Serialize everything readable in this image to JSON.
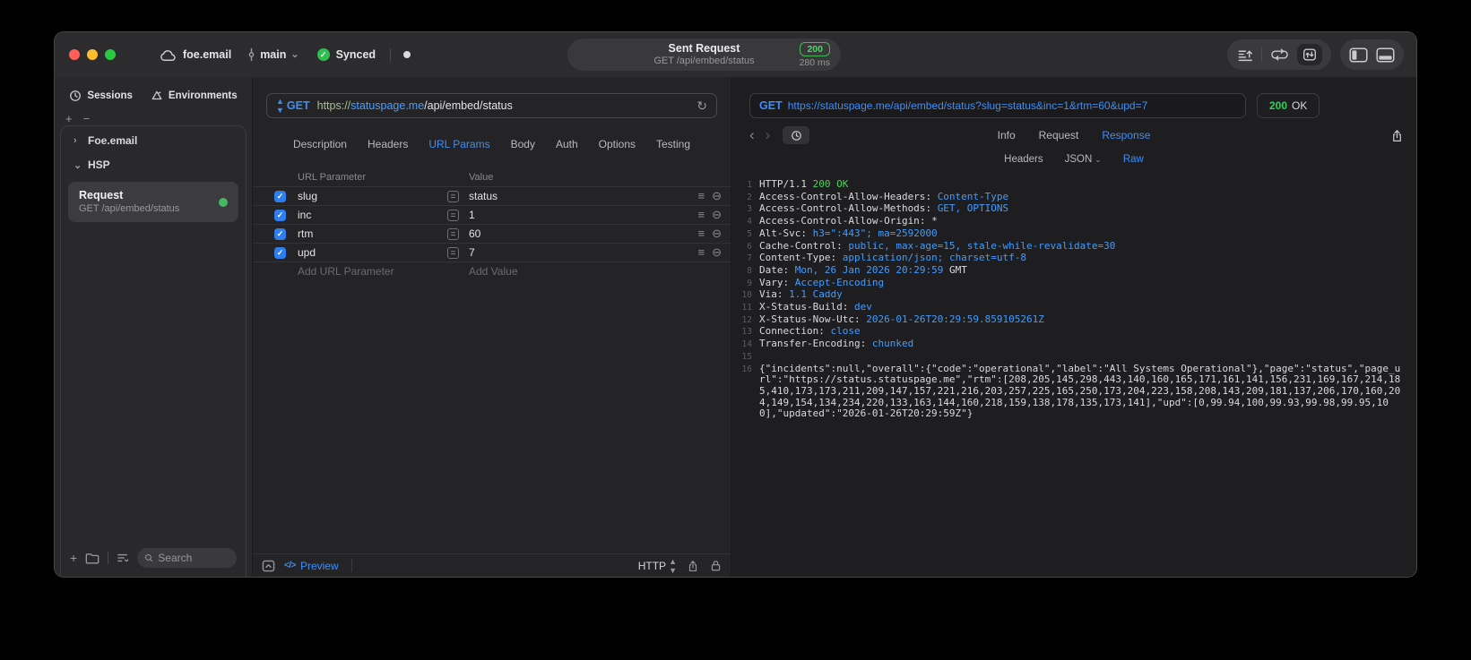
{
  "titlebar": {
    "project": "foe.email",
    "branch": "main",
    "sync_status": "Synced",
    "request_summary": {
      "title": "Sent Request",
      "subtitle": "GET /api/embed/status",
      "status_code": "200",
      "duration": "280 ms"
    }
  },
  "sidebar": {
    "tabs": [
      {
        "label": "Sessions"
      },
      {
        "label": "Environments"
      }
    ],
    "tree": [
      {
        "label": "Foe.email",
        "state": "collapsed"
      },
      {
        "label": "HSP",
        "state": "expanded"
      }
    ],
    "request_item": {
      "title": "Request",
      "subtitle": "GET /api/embed/status"
    },
    "search_placeholder": "Search"
  },
  "request": {
    "method": "GET",
    "url": {
      "scheme": "https://",
      "host": "statuspage.me",
      "path": "/api/embed/status"
    },
    "tabs": [
      "Description",
      "Headers",
      "URL Params",
      "Body",
      "Auth",
      "Options",
      "Testing"
    ],
    "active_tab": "URL Params",
    "params": {
      "columns": [
        "URL Parameter",
        "Value"
      ],
      "rows": [
        {
          "name": "slug",
          "value": "status",
          "enabled": true
        },
        {
          "name": "inc",
          "value": "1",
          "enabled": true
        },
        {
          "name": "rtm",
          "value": "60",
          "enabled": true
        },
        {
          "name": "upd",
          "value": "7",
          "enabled": true
        }
      ],
      "add_parameter_placeholder": "Add URL Parameter",
      "add_value_placeholder": "Add Value"
    },
    "footer": {
      "preview_label": "Preview",
      "protocol": "HTTP"
    }
  },
  "response": {
    "method": "GET",
    "url": "https://statuspage.me/api/embed/status?slug=status&inc=1&rtm=60&upd=7",
    "status_code": "200",
    "status_text": "OK",
    "tabs": [
      "Info",
      "Request",
      "Response"
    ],
    "active_tab": "Response",
    "subtabs": [
      "Headers",
      "JSON",
      "Raw"
    ],
    "active_subtab": "Raw",
    "raw_lines": [
      {
        "n": 1,
        "segs": [
          [
            "HTTP/1.1 ",
            "w"
          ],
          [
            "200 OK",
            "g"
          ]
        ]
      },
      {
        "n": 2,
        "segs": [
          [
            "Access-Control-Allow-Headers",
            "w"
          ],
          [
            ": ",
            "w"
          ],
          [
            "Content-Type",
            "b"
          ]
        ]
      },
      {
        "n": 3,
        "segs": [
          [
            "Access-Control-Allow-Methods",
            "w"
          ],
          [
            ": ",
            "w"
          ],
          [
            "GET, OPTIONS",
            "b"
          ]
        ]
      },
      {
        "n": 4,
        "segs": [
          [
            "Access-Control-Allow-Origin",
            "w"
          ],
          [
            ": ",
            "w"
          ],
          [
            "*",
            "w"
          ]
        ]
      },
      {
        "n": 5,
        "segs": [
          [
            "Alt-Svc",
            "w"
          ],
          [
            ": ",
            "w"
          ],
          [
            "h3=\":443\"; ma=2592000",
            "b"
          ]
        ]
      },
      {
        "n": 6,
        "segs": [
          [
            "Cache-Control",
            "w"
          ],
          [
            ": ",
            "w"
          ],
          [
            "public, max-age=15, stale-while-revalidate=30",
            "b"
          ]
        ]
      },
      {
        "n": 7,
        "segs": [
          [
            "Content-Type",
            "w"
          ],
          [
            ": ",
            "w"
          ],
          [
            "application/json; charset=utf-8",
            "b"
          ]
        ]
      },
      {
        "n": 8,
        "segs": [
          [
            "Date",
            "w"
          ],
          [
            ": ",
            "w"
          ],
          [
            "Mon, 26 Jan 2026 20:29:59",
            "b"
          ],
          [
            " GMT",
            "w"
          ]
        ]
      },
      {
        "n": 9,
        "segs": [
          [
            "Vary",
            "w"
          ],
          [
            ": ",
            "w"
          ],
          [
            "Accept-Encoding",
            "b"
          ]
        ]
      },
      {
        "n": 10,
        "segs": [
          [
            "Via",
            "w"
          ],
          [
            ": ",
            "w"
          ],
          [
            "1.1 Caddy",
            "b"
          ]
        ]
      },
      {
        "n": 11,
        "segs": [
          [
            "X-Status-Build",
            "w"
          ],
          [
            ": ",
            "w"
          ],
          [
            "dev",
            "b"
          ]
        ]
      },
      {
        "n": 12,
        "segs": [
          [
            "X-Status-Now-Utc",
            "w"
          ],
          [
            ": ",
            "w"
          ],
          [
            "2026-01-26T20:29:59.859105261Z",
            "b"
          ]
        ]
      },
      {
        "n": 13,
        "segs": [
          [
            "Connection",
            "w"
          ],
          [
            ": ",
            "w"
          ],
          [
            "close",
            "b"
          ]
        ]
      },
      {
        "n": 14,
        "segs": [
          [
            "Transfer-Encoding",
            "w"
          ],
          [
            ": ",
            "w"
          ],
          [
            "chunked",
            "b"
          ]
        ]
      },
      {
        "n": 15,
        "segs": []
      },
      {
        "n": 16,
        "body": true
      }
    ],
    "body_text": "{\"incidents\":null,\"overall\":{\"code\":\"operational\",\"label\":\"All Systems Operational\"},\"page\":\"status\",\"page_url\":\"https://status.statuspage.me\",\"rtm\":[208,205,145,298,443,140,160,165,171,161,141,156,231,169,167,214,185,410,173,173,211,209,147,157,221,216,203,257,225,165,250,173,204,223,158,208,143,209,181,137,206,170,160,204,149,154,134,234,220,133,163,144,160,218,159,138,178,135,173,141],\"upd\":[0,99.94,100,99.93,99.98,99.95,100],\"updated\":\"2026-01-26T20:29:59Z\"}"
  },
  "colors": {
    "accent_blue": "#3f8ef7",
    "status_green": "#30d158",
    "code_blue": "#419cff",
    "code_green": "#4fd35a",
    "checkbox_blue": "#2e7ef0",
    "traffic_red": "#ff5f57",
    "traffic_yellow": "#febc2e",
    "traffic_green": "#28c840"
  }
}
